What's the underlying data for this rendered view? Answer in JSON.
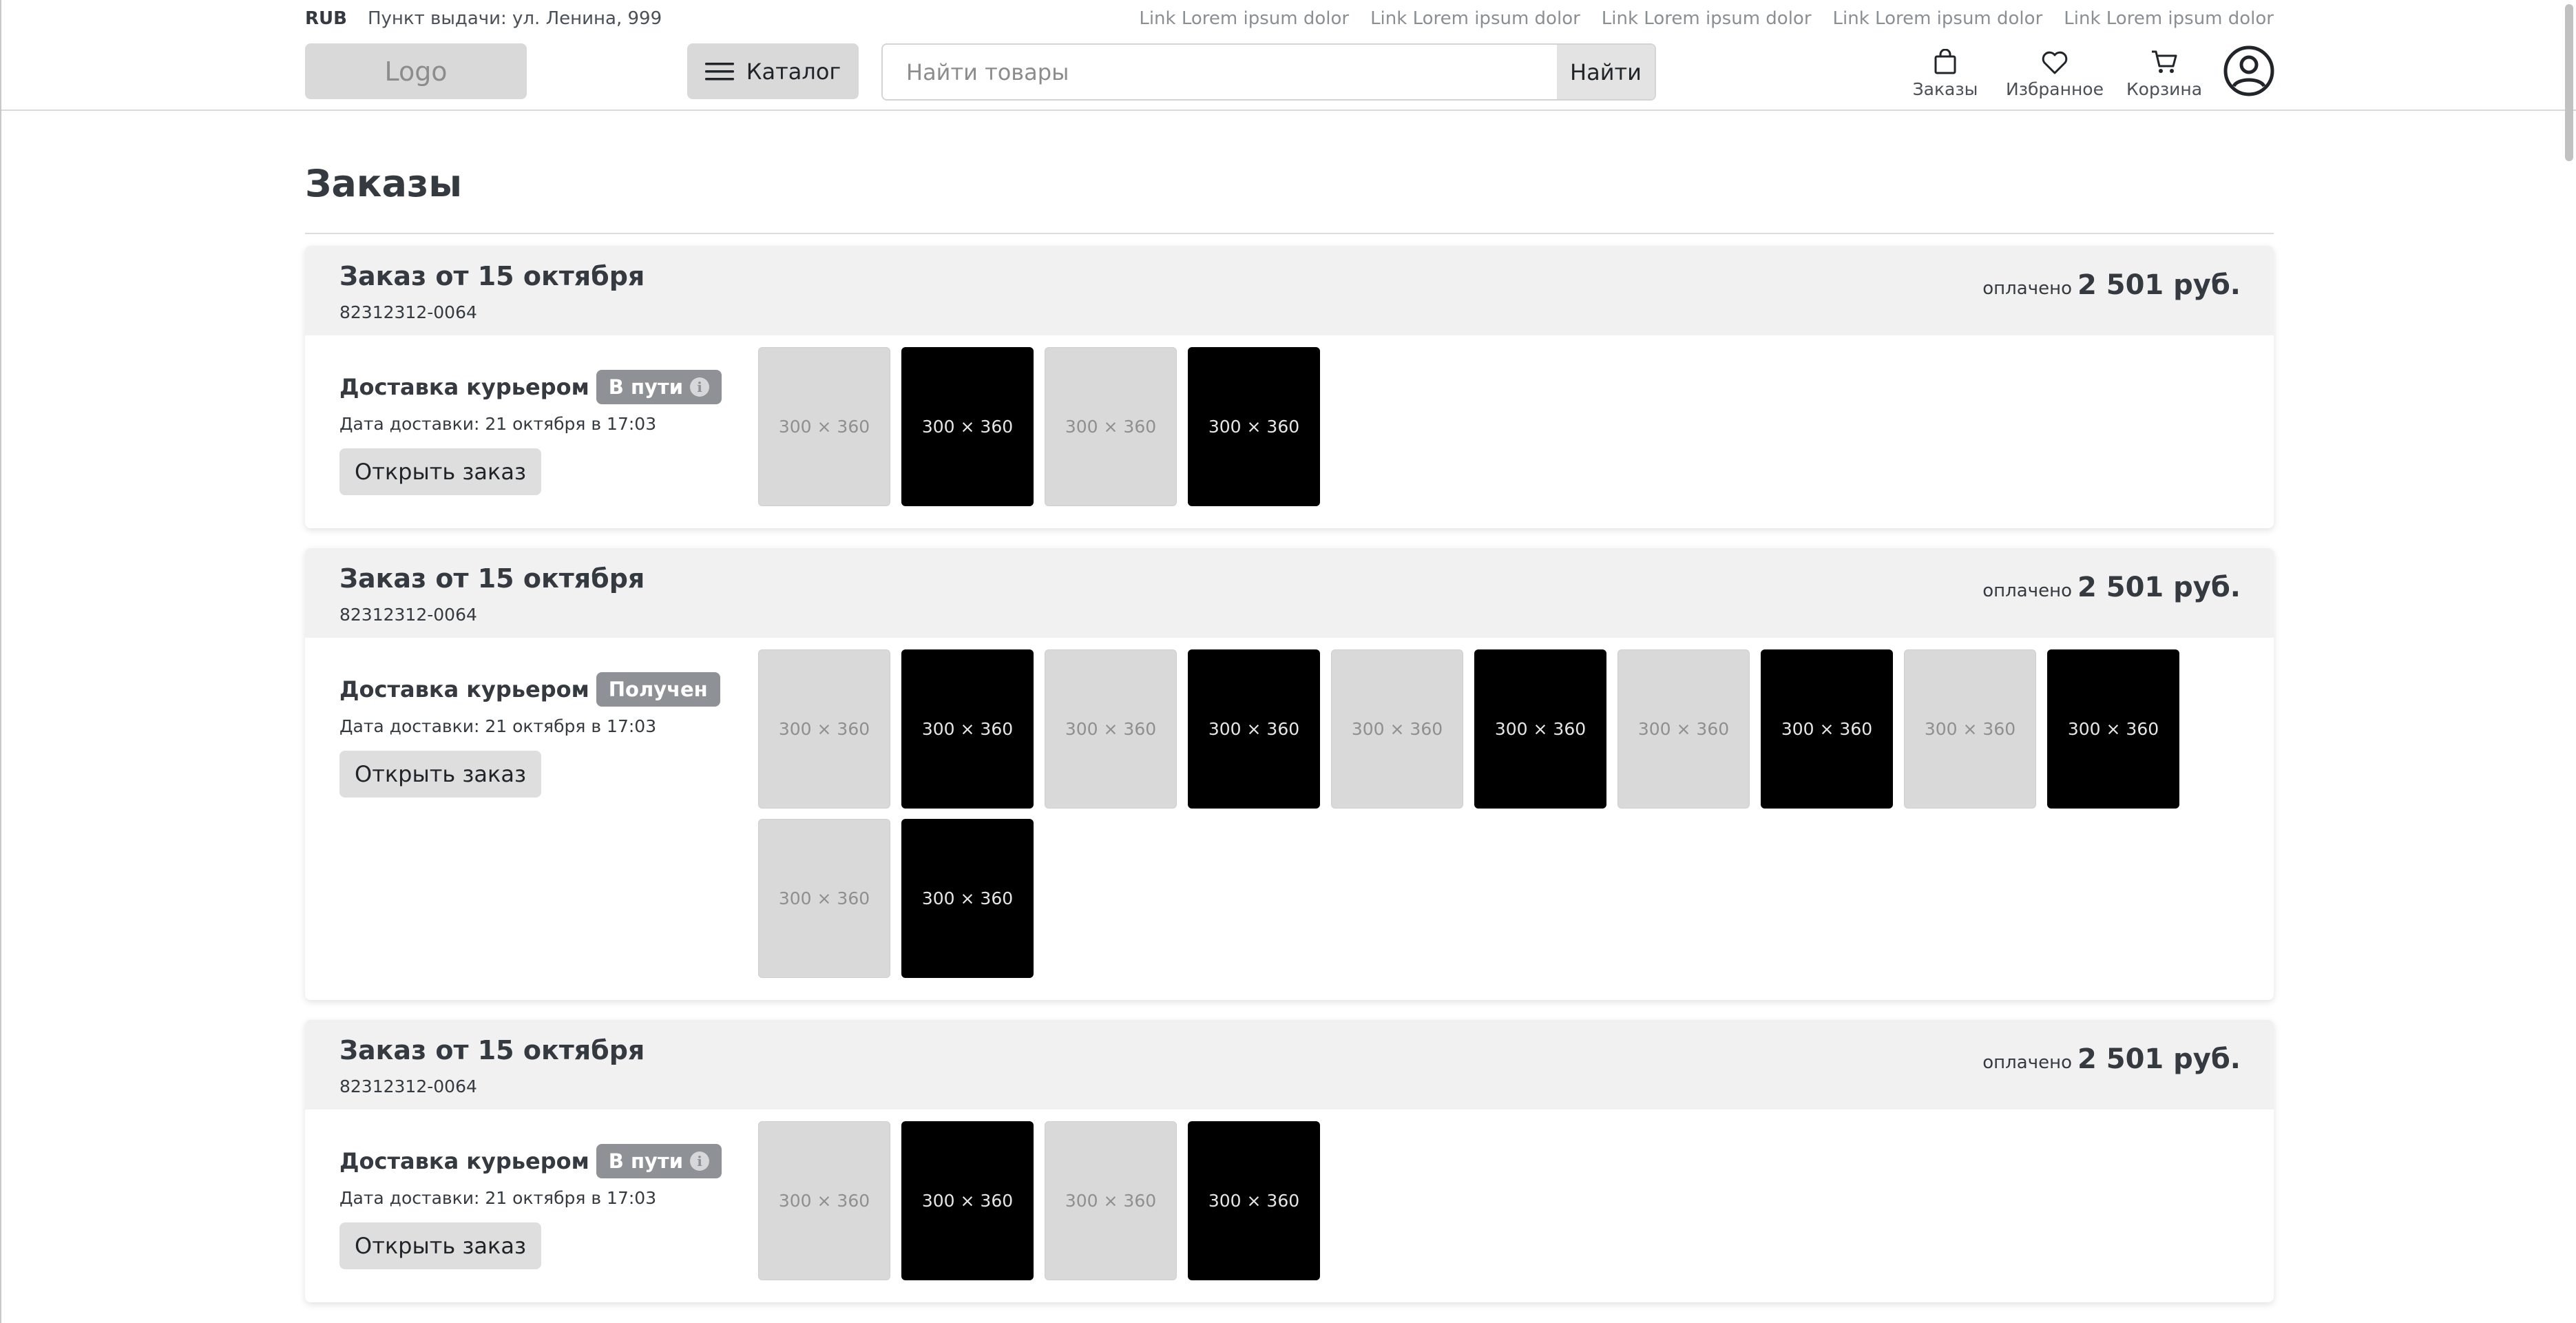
{
  "topbar": {
    "currency": "RUB",
    "pickup": "Пункт выдачи: ул. Ленина, 999",
    "links": [
      "Link Lorem ipsum dolor",
      "Link Lorem ipsum dolor",
      "Link Lorem ipsum dolor",
      "Link Lorem ipsum dolor",
      "Link Lorem ipsum dolor"
    ]
  },
  "header": {
    "logo": "Logo",
    "catalog_label": "Каталог",
    "search_placeholder": "Найти товары",
    "search_button": "Найти",
    "nav": {
      "orders": "Заказы",
      "favorites": "Избранное",
      "cart": "Корзина"
    }
  },
  "page": {
    "title": "Заказы"
  },
  "orders": [
    {
      "title": "Заказ от 15 октября",
      "number": "82312312-0064",
      "paid_label": "оплачено",
      "paid_sum": "2 501 руб.",
      "delivery_label": "Доставка курьером",
      "status": "В пути",
      "status_info": "i",
      "delivery_date": "Дата доставки: 21 октября в 17:03",
      "open_button": "Открыть заказ",
      "thumbs": [
        {
          "label": "300 × 360",
          "style": "light"
        },
        {
          "label": "300 × 360",
          "style": "dark"
        },
        {
          "label": "300 × 360",
          "style": "light"
        },
        {
          "label": "300 × 360",
          "style": "dark"
        }
      ]
    },
    {
      "title": "Заказ от 15 октября",
      "number": "82312312-0064",
      "paid_label": "оплачено",
      "paid_sum": "2 501 руб.",
      "delivery_label": "Доставка курьером",
      "status": "Получен",
      "status_info": "",
      "delivery_date": "Дата доставки: 21 октября в 17:03",
      "open_button": "Открыть заказ",
      "thumbs": [
        {
          "label": "300 × 360",
          "style": "light"
        },
        {
          "label": "300 × 360",
          "style": "dark"
        },
        {
          "label": "300 × 360",
          "style": "light"
        },
        {
          "label": "300 × 360",
          "style": "dark"
        },
        {
          "label": "300 × 360",
          "style": "light"
        },
        {
          "label": "300 × 360",
          "style": "dark"
        },
        {
          "label": "300 × 360",
          "style": "light"
        },
        {
          "label": "300 × 360",
          "style": "dark"
        },
        {
          "label": "300 × 360",
          "style": "light"
        },
        {
          "label": "300 × 360",
          "style": "dark"
        },
        {
          "label": "300 × 360",
          "style": "light"
        },
        {
          "label": "300 × 360",
          "style": "dark"
        }
      ]
    },
    {
      "title": "Заказ от 15 октября",
      "number": "82312312-0064",
      "paid_label": "оплачено",
      "paid_sum": "2 501 руб.",
      "delivery_label": "Доставка курьером",
      "status": "В пути",
      "status_info": "i",
      "delivery_date": "Дата доставки: 21 октября в 17:03",
      "open_button": "Открыть заказ",
      "thumbs": [
        {
          "label": "300 × 360",
          "style": "light"
        },
        {
          "label": "300 × 360",
          "style": "dark"
        },
        {
          "label": "300 × 360",
          "style": "light"
        },
        {
          "label": "300 × 360",
          "style": "dark"
        }
      ]
    }
  ]
}
